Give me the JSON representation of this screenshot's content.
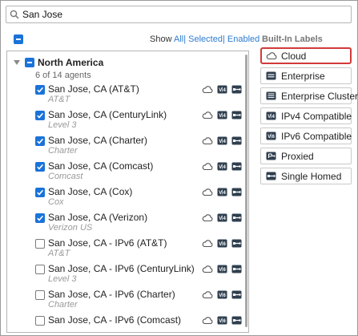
{
  "search": {
    "value": "San Jose"
  },
  "show_bar": {
    "show": "Show",
    "all": "All",
    "selected": "Selected",
    "enabled": "Enabled"
  },
  "group": {
    "name": "North America",
    "count": "6 of 14 agents"
  },
  "agents": [
    {
      "name": "San Jose, CA (AT&T)",
      "provider": "AT&T",
      "checked": true,
      "ip": "v4"
    },
    {
      "name": "San Jose, CA (CenturyLink)",
      "provider": "Level 3",
      "checked": true,
      "ip": "v4"
    },
    {
      "name": "San Jose, CA (Charter)",
      "provider": "Charter",
      "checked": true,
      "ip": "v4"
    },
    {
      "name": "San Jose, CA (Comcast)",
      "provider": "Comcast",
      "checked": true,
      "ip": "v4"
    },
    {
      "name": "San Jose, CA (Cox)",
      "provider": "Cox",
      "checked": true,
      "ip": "v4"
    },
    {
      "name": "San Jose, CA (Verizon)",
      "provider": "Verizon US",
      "checked": true,
      "ip": "v4"
    },
    {
      "name": "San Jose, CA - IPv6 (AT&T)",
      "provider": "AT&T",
      "checked": false,
      "ip": "v6"
    },
    {
      "name": "San Jose, CA - IPv6 (CenturyLink)",
      "provider": "Level 3",
      "checked": false,
      "ip": "v6"
    },
    {
      "name": "San Jose, CA - IPv6 (Charter)",
      "provider": "Charter",
      "checked": false,
      "ip": "v6"
    },
    {
      "name": "San Jose, CA - IPv6 (Comcast)",
      "provider": "",
      "checked": false,
      "ip": "v6"
    }
  ],
  "builtin": {
    "title": "Built-In Labels",
    "labels": [
      {
        "label": "Cloud",
        "icon": "cloud-icon",
        "selected": true
      },
      {
        "label": "Enterprise",
        "icon": "enterprise-icon",
        "selected": false
      },
      {
        "label": "Enterprise Cluster",
        "icon": "enterprise-cluster-icon",
        "selected": false
      },
      {
        "label": "IPv4 Compatible",
        "icon": "ipv4-icon",
        "selected": false
      },
      {
        "label": "IPv6 Compatible",
        "icon": "ipv6-icon",
        "selected": false
      },
      {
        "label": "Proxied",
        "icon": "proxied-icon",
        "selected": false
      },
      {
        "label": "Single Homed",
        "icon": "single-homed-icon",
        "selected": false
      }
    ]
  },
  "colors": {
    "accent": "#1a73d9",
    "link": "#2d7bd0",
    "highlight": "#d23a3a",
    "icon": "#2f3f4f"
  }
}
